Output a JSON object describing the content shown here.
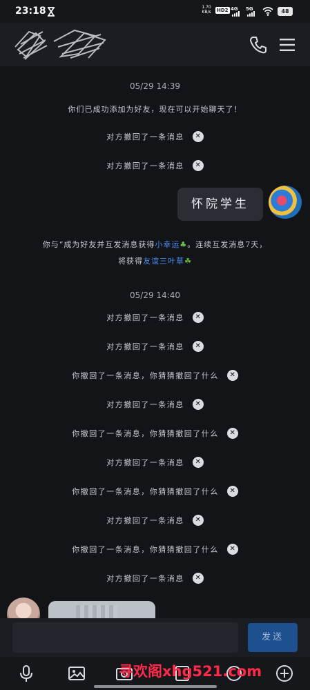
{
  "status_bar": {
    "time": "23:18",
    "net_speed_value": "1.70",
    "net_speed_unit": "KB/s",
    "hd_label": "HD2",
    "signal_1": "4G",
    "signal_2": "5G",
    "battery": "48"
  },
  "header": {
    "phone_icon": "phone-icon",
    "menu_icon": "menu-icon"
  },
  "chat": {
    "timestamp_1": "05/29 14:39",
    "friend_added": "你们已成功添加为好友，现在可以开始聊天了！",
    "recall_other": "对方撤回了一条消息",
    "my_message": "怀院学生",
    "streak_line1_a": "你与“成为好友并互发消息获得",
    "streak_line1_b": "小幸运",
    "streak_line1_c": "。连续互发消息7天，",
    "streak_line2_a": "将获得",
    "streak_line2_b": "友谊三叶草",
    "timestamp_2": "05/29 14:40",
    "recall_self": "你撤回了一条消息，你猜猜撤回了什么"
  },
  "input": {
    "placeholder": "",
    "send_label": "发送"
  },
  "watermark": "寻欢阁xhg521.com",
  "colors": {
    "background": "#121418",
    "link_blue": "#4b8ff0",
    "send_button": "#1e4f8f",
    "watermark_red": "#ff2a4a"
  }
}
